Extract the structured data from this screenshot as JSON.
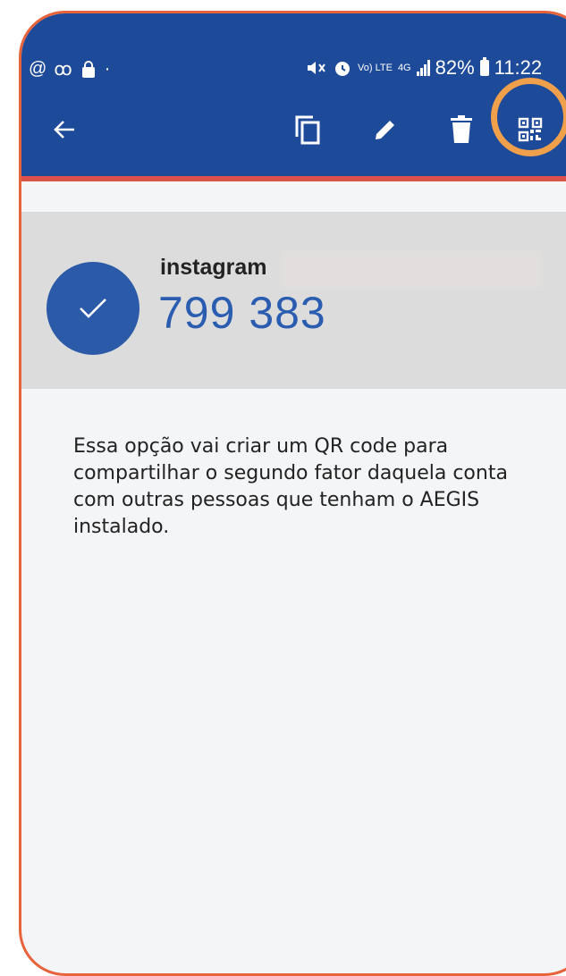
{
  "status_bar": {
    "left_icons": [
      "at-icon",
      "voicemail-icon",
      "shopping-bag-icon",
      "dot-icon"
    ],
    "volte_label": "Vo) LTE",
    "network_label": "4G",
    "battery_percent": "82%",
    "time": "11:22"
  },
  "toolbar": {
    "back_icon": "arrow-left-icon",
    "copy_icon": "copy-icon",
    "edit_icon": "pencil-icon",
    "delete_icon": "trash-icon",
    "qr_icon": "qr-code-icon"
  },
  "entry": {
    "issuer": "instagram",
    "code": "799 383"
  },
  "description": "Essa opção vai criar um QR code para compartilhar o segundo fator daquela conta com outras pessoas que tenham o AEGIS instalado.",
  "colors": {
    "header": "#1e4a9a",
    "highlight": "#f0a04b",
    "frame": "#e8623a",
    "code": "#2a5cb0"
  }
}
